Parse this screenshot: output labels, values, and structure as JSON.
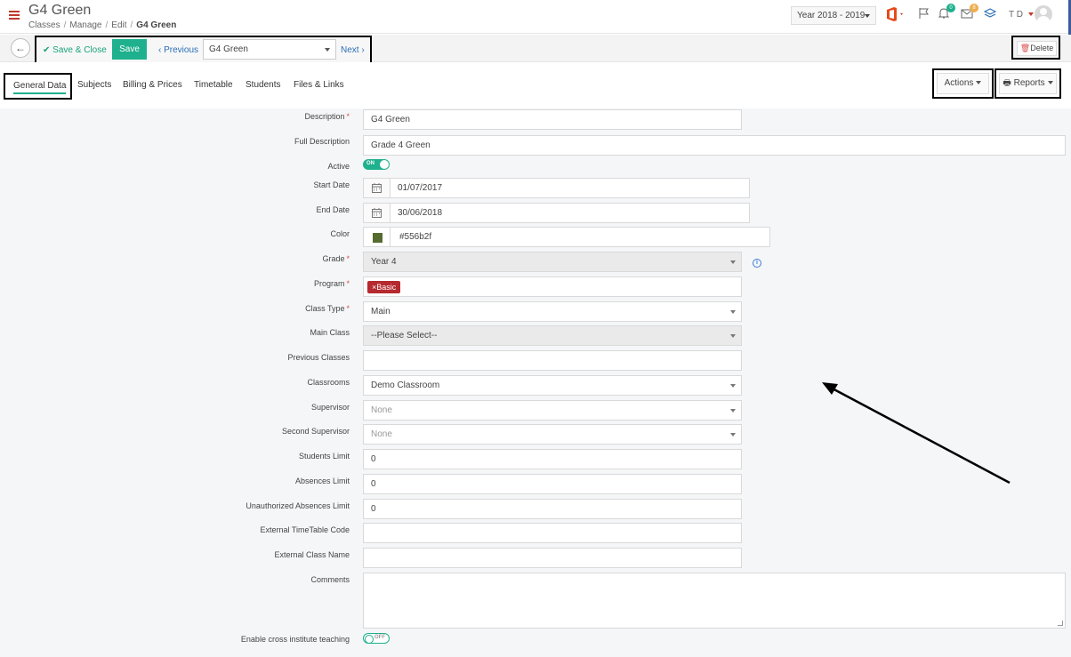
{
  "header": {
    "title": "G4 Green",
    "breadcrumb": [
      "Classes",
      "Manage",
      "Edit",
      "G4 Green"
    ],
    "year": "Year 2018 - 2019",
    "user": "T D",
    "notification_count": "0",
    "message_count": "8",
    "accent": "#c0392b"
  },
  "toolbar": {
    "save_close_label": "Save & Close",
    "save_label": "Save",
    "previous_label": "Previous",
    "class_value": "G4 Green",
    "next_label": "Next",
    "delete_label": "Delete"
  },
  "tabs": {
    "items": [
      "General Data",
      "Subjects",
      "Billing & Prices",
      "Timetable",
      "Students",
      "Files & Links"
    ],
    "active": "General Data",
    "actions_label": "Actions",
    "reports_label": "Reports"
  },
  "form": {
    "description": {
      "label": "Description",
      "value": "G4 Green"
    },
    "full_description": {
      "label": "Full Description",
      "value": "Grade 4 Green"
    },
    "active": {
      "label": "Active",
      "value": "ON"
    },
    "start_date": {
      "label": "Start Date",
      "value": "01/07/2017"
    },
    "end_date": {
      "label": "End Date",
      "value": "30/06/2018"
    },
    "color": {
      "label": "Color",
      "value": "#556b2f"
    },
    "grade": {
      "label": "Grade",
      "value": "Year 4"
    },
    "program": {
      "label": "Program",
      "value": "Basic"
    },
    "class_type": {
      "label": "Class Type",
      "value": "Main"
    },
    "main_class": {
      "label": "Main Class",
      "value": "--Please Select--"
    },
    "previous_classes": {
      "label": "Previous Classes",
      "value": ""
    },
    "classrooms": {
      "label": "Classrooms",
      "value": "Demo Classroom"
    },
    "supervisor": {
      "label": "Supervisor",
      "value": "None"
    },
    "second_supervisor": {
      "label": "Second Supervisor",
      "value": "None"
    },
    "students_limit": {
      "label": "Students Limit",
      "value": "0"
    },
    "absences_limit": {
      "label": "Absences Limit",
      "value": "0"
    },
    "unauthorized_absences_limit": {
      "label": "Unauthorized Absences Limit",
      "value": "0"
    },
    "external_timetable_code": {
      "label": "External TimeTable Code",
      "value": ""
    },
    "external_class_name": {
      "label": "External Class Name",
      "value": ""
    },
    "comments": {
      "label": "Comments",
      "value": ""
    },
    "cross_institute": {
      "label": "Enable cross institute teaching",
      "value": "OFF"
    }
  }
}
